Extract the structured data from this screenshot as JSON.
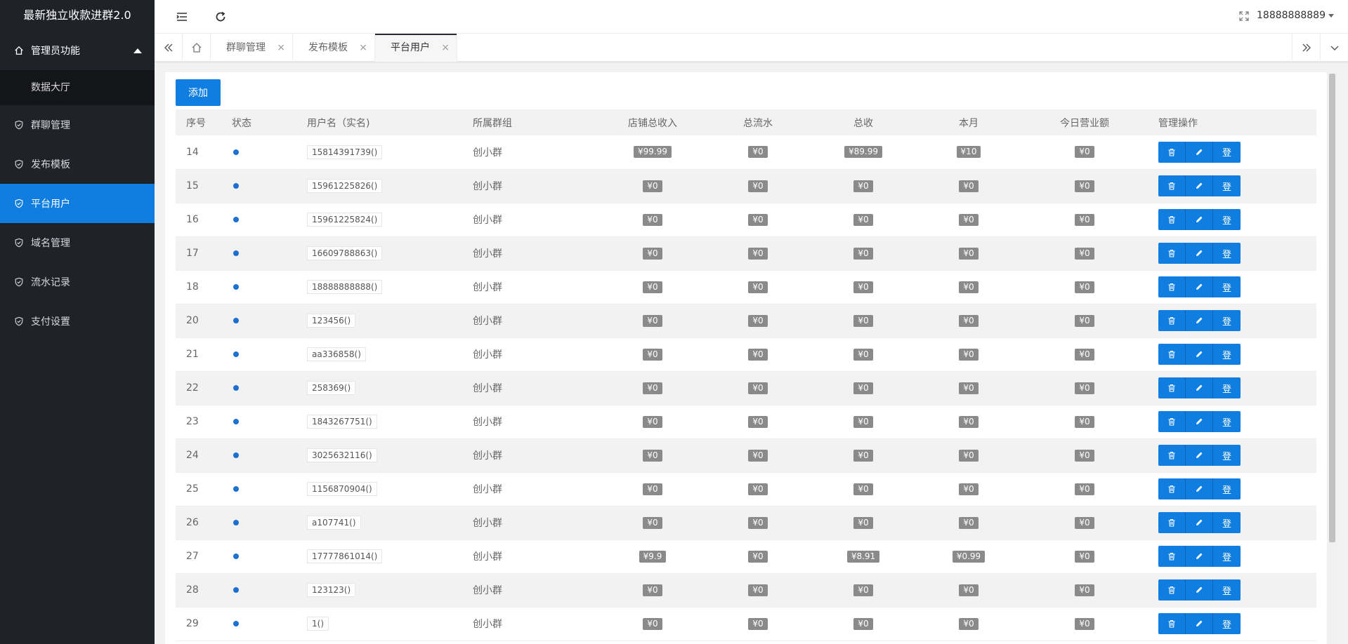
{
  "app": {
    "title": "最新独立收款进群2.0",
    "username": "18888888889"
  },
  "sidebar": {
    "group_label": "管理员功能",
    "sub_items": [
      "数据大厅"
    ],
    "items": [
      {
        "label": "群聊管理",
        "active": false
      },
      {
        "label": "发布模板",
        "active": false
      },
      {
        "label": "平台用户",
        "active": true
      },
      {
        "label": "域名管理",
        "active": false
      },
      {
        "label": "流水记录",
        "active": false
      },
      {
        "label": "支付设置",
        "active": false
      }
    ]
  },
  "tabs": [
    {
      "label": "群聊管理",
      "active": false
    },
    {
      "label": "发布模板",
      "active": false
    },
    {
      "label": "平台用户",
      "active": true
    }
  ],
  "toolbar": {
    "add_label": "添加"
  },
  "table": {
    "columns": [
      "序号",
      "状态",
      "用户名（实名)",
      "所属群组",
      "店铺总收入",
      "总流水",
      "总收",
      "本月",
      "今日营业额",
      "管理操作"
    ],
    "op_login_label": "登",
    "rows": [
      {
        "id": "14",
        "user": "15814391739()",
        "group": "创小群",
        "income": "¥99.99",
        "flow": "¥0",
        "total": "¥89.99",
        "month": "¥10",
        "today": "¥0"
      },
      {
        "id": "15",
        "user": "15961225826()",
        "group": "创小群",
        "income": "¥0",
        "flow": "¥0",
        "total": "¥0",
        "month": "¥0",
        "today": "¥0"
      },
      {
        "id": "16",
        "user": "15961225824()",
        "group": "创小群",
        "income": "¥0",
        "flow": "¥0",
        "total": "¥0",
        "month": "¥0",
        "today": "¥0"
      },
      {
        "id": "17",
        "user": "16609788863()",
        "group": "创小群",
        "income": "¥0",
        "flow": "¥0",
        "total": "¥0",
        "month": "¥0",
        "today": "¥0"
      },
      {
        "id": "18",
        "user": "18888888888()",
        "group": "创小群",
        "income": "¥0",
        "flow": "¥0",
        "total": "¥0",
        "month": "¥0",
        "today": "¥0"
      },
      {
        "id": "20",
        "user": "123456()",
        "group": "创小群",
        "income": "¥0",
        "flow": "¥0",
        "total": "¥0",
        "month": "¥0",
        "today": "¥0"
      },
      {
        "id": "21",
        "user": "aa336858()",
        "group": "创小群",
        "income": "¥0",
        "flow": "¥0",
        "total": "¥0",
        "month": "¥0",
        "today": "¥0"
      },
      {
        "id": "22",
        "user": "258369()",
        "group": "创小群",
        "income": "¥0",
        "flow": "¥0",
        "total": "¥0",
        "month": "¥0",
        "today": "¥0"
      },
      {
        "id": "23",
        "user": "1843267751()",
        "group": "创小群",
        "income": "¥0",
        "flow": "¥0",
        "total": "¥0",
        "month": "¥0",
        "today": "¥0"
      },
      {
        "id": "24",
        "user": "3025632116()",
        "group": "创小群",
        "income": "¥0",
        "flow": "¥0",
        "total": "¥0",
        "month": "¥0",
        "today": "¥0"
      },
      {
        "id": "25",
        "user": "1156870904()",
        "group": "创小群",
        "income": "¥0",
        "flow": "¥0",
        "total": "¥0",
        "month": "¥0",
        "today": "¥0"
      },
      {
        "id": "26",
        "user": "a107741()",
        "group": "创小群",
        "income": "¥0",
        "flow": "¥0",
        "total": "¥0",
        "month": "¥0",
        "today": "¥0"
      },
      {
        "id": "27",
        "user": "17777861014()",
        "group": "创小群",
        "income": "¥9.9",
        "flow": "¥0",
        "total": "¥8.91",
        "month": "¥0.99",
        "today": "¥0"
      },
      {
        "id": "28",
        "user": "123123()",
        "group": "创小群",
        "income": "¥0",
        "flow": "¥0",
        "total": "¥0",
        "month": "¥0",
        "today": "¥0"
      },
      {
        "id": "29",
        "user": "1()",
        "group": "创小群",
        "income": "¥0",
        "flow": "¥0",
        "total": "¥0",
        "month": "¥0",
        "today": "¥0"
      }
    ]
  },
  "icons": {
    "sidebar_item": "shield-check-icon",
    "group": "home-icon",
    "menu_toggle": "menu-fold-icon",
    "refresh": "refresh-icon",
    "fullscreen": "fullscreen-icon",
    "op_delete": "trash-icon",
    "op_edit": "pencil-icon"
  },
  "colors": {
    "accent": "#0f7ee0",
    "sidebar_bg": "#20222a",
    "status_dot": "#1e6fd0",
    "money_badge": "#8a8a8a"
  }
}
